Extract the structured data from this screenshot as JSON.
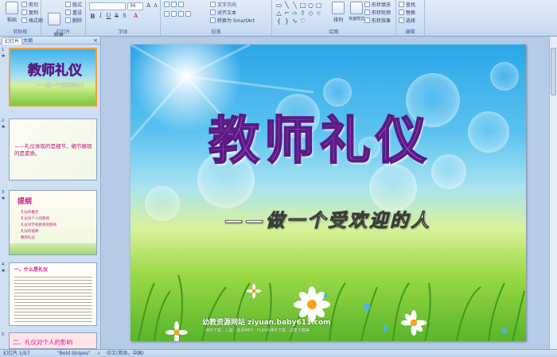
{
  "ribbon": {
    "clipboard": {
      "paste": "粘贴",
      "cut": "剪切",
      "copy": "复制",
      "format_painter": "格式刷",
      "label": "剪贴板"
    },
    "slides": {
      "new_slide": "新建\n幻灯片",
      "layout": "版式",
      "reset": "重设",
      "delete": "删除",
      "label": "幻灯片"
    },
    "font": {
      "size": "36",
      "bold": "B",
      "italic": "I",
      "underline": "U",
      "strike": "S",
      "shadow": "S",
      "label": "字体"
    },
    "paragraph": {
      "text_direction": "文字方向",
      "align_text": "对齐文本",
      "smartart": "转换为 SmartArt",
      "label": "段落"
    },
    "drawing": {
      "arrange": "排列",
      "quick_styles": "快速样式",
      "shape_fill": "形状填充",
      "shape_outline": "形状轮廓",
      "shape_effects": "形状效果",
      "label": "绘图"
    },
    "editing": {
      "find": "查找",
      "replace": "替换",
      "select": "选择",
      "label": "编辑"
    }
  },
  "left_pane": {
    "tab_slides": "幻灯片",
    "tab_outline": "大纲",
    "close": "×",
    "thumbnails": [
      {
        "num": "1",
        "title": "教师礼仪",
        "subtitle": "——做一个受欢迎的人"
      },
      {
        "num": "2",
        "text": "——礼仪体现的是细节，细节展现的是素质。"
      },
      {
        "num": "3",
        "title": "提纲",
        "items": [
          "礼仪的概念",
          "礼仪对个人的影响",
          "礼仪对学校教育的影响",
          "礼仪的培养",
          "教师礼仪"
        ]
      },
      {
        "num": "4",
        "heading": "一、什么是礼仪"
      },
      {
        "num": "5",
        "heading": "二、礼仪对个人的影响"
      }
    ]
  },
  "slide": {
    "title": "教师礼仪",
    "subtitle": "——做一个受欢迎的人",
    "footer_site": "幼教资源网站  ziyuan.baby611.com",
    "footer_links": "课件下载 · 儿歌 · 故事MP3 · FLASH课件下载 · 试卷下载等"
  },
  "status_bar": {
    "slide_count": "幻灯片 1/57",
    "theme": "\"Bold Stripes\"",
    "language": "中文(简体，中国)"
  },
  "colors": {
    "title_fill": "#b24cd6",
    "title_stroke": "#5a1b84",
    "ribbon_bg": "#dbe7f6",
    "selected_border": "#f2a33a"
  }
}
